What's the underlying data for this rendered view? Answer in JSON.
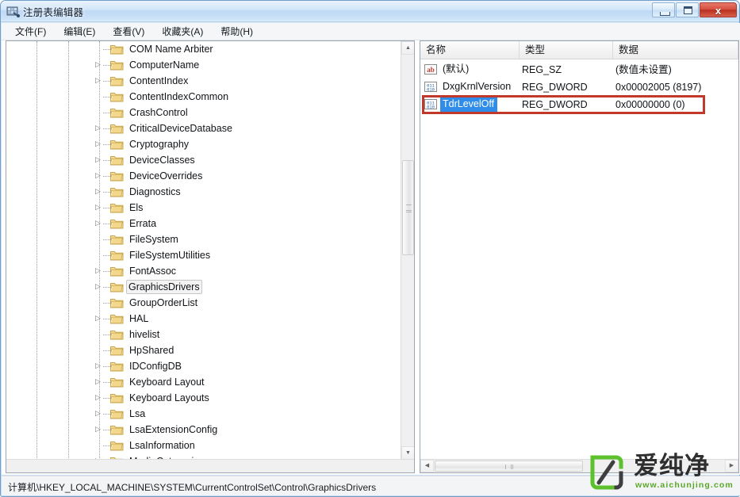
{
  "window": {
    "title": "注册表编辑器",
    "title_icon": "registry-editor-icon",
    "buttons": {
      "minimize": "最小化",
      "maximize": "最大化",
      "close": "x"
    }
  },
  "menubar": {
    "items": [
      {
        "label": "文件(F)",
        "name": "menu-file"
      },
      {
        "label": "编辑(E)",
        "name": "menu-edit"
      },
      {
        "label": "查看(V)",
        "name": "menu-view"
      },
      {
        "label": "收藏夹(A)",
        "name": "menu-favorites"
      },
      {
        "label": "帮助(H)",
        "name": "menu-help"
      }
    ]
  },
  "tree": {
    "nodes": [
      {
        "label": "COM Name Arbiter",
        "expandable": false,
        "selected": false
      },
      {
        "label": "ComputerName",
        "expandable": true,
        "selected": false
      },
      {
        "label": "ContentIndex",
        "expandable": true,
        "selected": false
      },
      {
        "label": "ContentIndexCommon",
        "expandable": false,
        "selected": false
      },
      {
        "label": "CrashControl",
        "expandable": false,
        "selected": false
      },
      {
        "label": "CriticalDeviceDatabase",
        "expandable": true,
        "selected": false
      },
      {
        "label": "Cryptography",
        "expandable": true,
        "selected": false
      },
      {
        "label": "DeviceClasses",
        "expandable": true,
        "selected": false
      },
      {
        "label": "DeviceOverrides",
        "expandable": true,
        "selected": false
      },
      {
        "label": "Diagnostics",
        "expandable": true,
        "selected": false
      },
      {
        "label": "Els",
        "expandable": true,
        "selected": false
      },
      {
        "label": "Errata",
        "expandable": true,
        "selected": false
      },
      {
        "label": "FileSystem",
        "expandable": false,
        "selected": false
      },
      {
        "label": "FileSystemUtilities",
        "expandable": false,
        "selected": false
      },
      {
        "label": "FontAssoc",
        "expandable": true,
        "selected": false
      },
      {
        "label": "GraphicsDrivers",
        "expandable": true,
        "selected": true
      },
      {
        "label": "GroupOrderList",
        "expandable": false,
        "selected": false
      },
      {
        "label": "HAL",
        "expandable": true,
        "selected": false
      },
      {
        "label": "hivelist",
        "expandable": false,
        "selected": false
      },
      {
        "label": "HpShared",
        "expandable": false,
        "selected": false
      },
      {
        "label": "IDConfigDB",
        "expandable": true,
        "selected": false
      },
      {
        "label": "Keyboard Layout",
        "expandable": true,
        "selected": false
      },
      {
        "label": "Keyboard Layouts",
        "expandable": true,
        "selected": false
      },
      {
        "label": "Lsa",
        "expandable": true,
        "selected": false
      },
      {
        "label": "LsaExtensionConfig",
        "expandable": true,
        "selected": false
      },
      {
        "label": "LsaInformation",
        "expandable": false,
        "selected": false
      },
      {
        "label": "MediaCategories",
        "expandable": true,
        "selected": false
      }
    ]
  },
  "list": {
    "columns": [
      {
        "label": "名称",
        "name": "column-name"
      },
      {
        "label": "类型",
        "name": "column-type"
      },
      {
        "label": "数据",
        "name": "column-data"
      }
    ],
    "rows": [
      {
        "name": "(默认)",
        "type": "REG_SZ",
        "data": "(数值未设置)",
        "icon": "reg-sz-icon",
        "selected": false
      },
      {
        "name": "DxgKrnlVersion",
        "type": "REG_DWORD",
        "data": "0x00002005 (8197)",
        "icon": "reg-dword-icon",
        "selected": false
      },
      {
        "name": "TdrLevelOff",
        "type": "REG_DWORD",
        "data": "0x00000000 (0)",
        "icon": "reg-dword-icon",
        "selected": true
      }
    ],
    "highlight_color": "#c0392b"
  },
  "statusbar": {
    "path": "计算机\\HKEY_LOCAL_MACHINE\\SYSTEM\\CurrentControlSet\\Control\\GraphicsDrivers"
  },
  "watermark": {
    "brand": "爱纯净",
    "url": "www.aichunjing.com",
    "color": "#5aa82a"
  }
}
